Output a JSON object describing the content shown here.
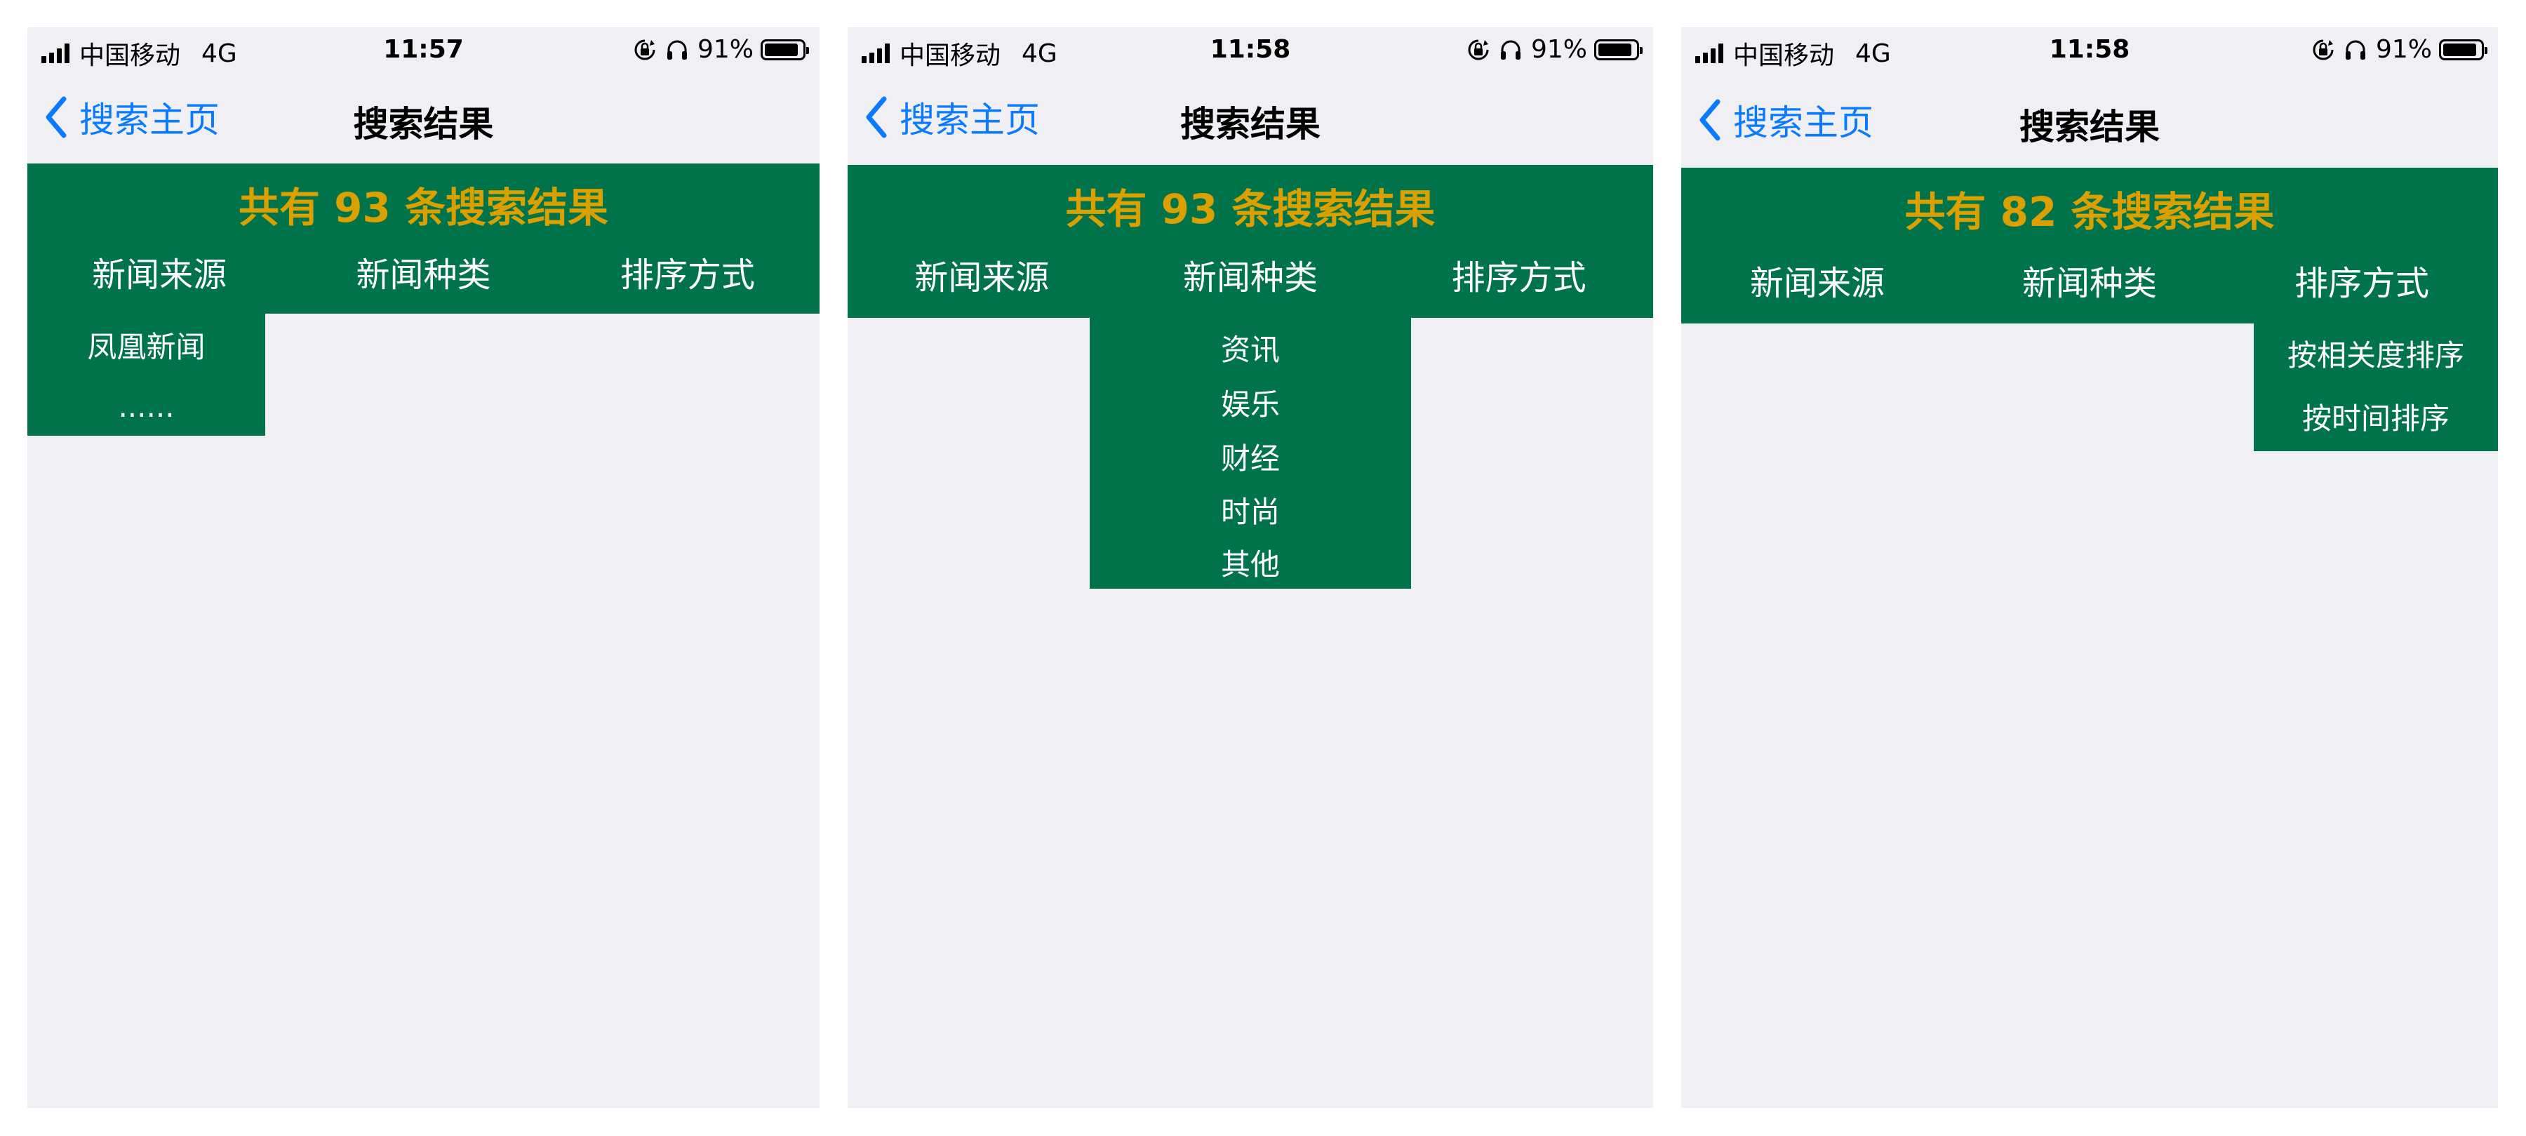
{
  "colors": {
    "accent_green": "#00734b",
    "count_gold": "#d9a000",
    "link_blue": "#0a7aff",
    "background": "#efeff4"
  },
  "screens": [
    {
      "status": {
        "carrier": "中国移动",
        "network": "4G",
        "time": "11:57",
        "battery": "91%",
        "icons": [
          "rotation-lock-icon",
          "headphones-icon",
          "battery-icon"
        ]
      },
      "nav": {
        "back_label": "搜索主页",
        "title": "搜索结果"
      },
      "result_count": "共有 93 条搜索结果",
      "tabs": [
        "新闻来源",
        "新闻种类",
        "排序方式"
      ],
      "dropdown": {
        "open_tab": "新闻来源",
        "items": [
          "凤凰新闻",
          "......"
        ]
      }
    },
    {
      "status": {
        "carrier": "中国移动",
        "network": "4G",
        "time": "11:58",
        "battery": "91%",
        "icons": [
          "rotation-lock-icon",
          "headphones-icon",
          "battery-icon"
        ]
      },
      "nav": {
        "back_label": "搜索主页",
        "title": "搜索结果"
      },
      "result_count": "共有 93 条搜索结果",
      "tabs": [
        "新闻来源",
        "新闻种类",
        "排序方式"
      ],
      "dropdown": {
        "open_tab": "新闻种类",
        "items": [
          "资讯",
          "娱乐",
          "财经",
          "时尚",
          "其他"
        ]
      }
    },
    {
      "status": {
        "carrier": "中国移动",
        "network": "4G",
        "time": "11:58",
        "battery": "91%",
        "icons": [
          "rotation-lock-icon",
          "headphones-icon",
          "battery-icon"
        ]
      },
      "nav": {
        "back_label": "搜索主页",
        "title": "搜索结果"
      },
      "result_count": "共有 82 条搜索结果",
      "tabs": [
        "新闻来源",
        "新闻种类",
        "排序方式"
      ],
      "dropdown": {
        "open_tab": "排序方式",
        "items": [
          "按相关度排序",
          "按时间排序"
        ]
      }
    }
  ]
}
